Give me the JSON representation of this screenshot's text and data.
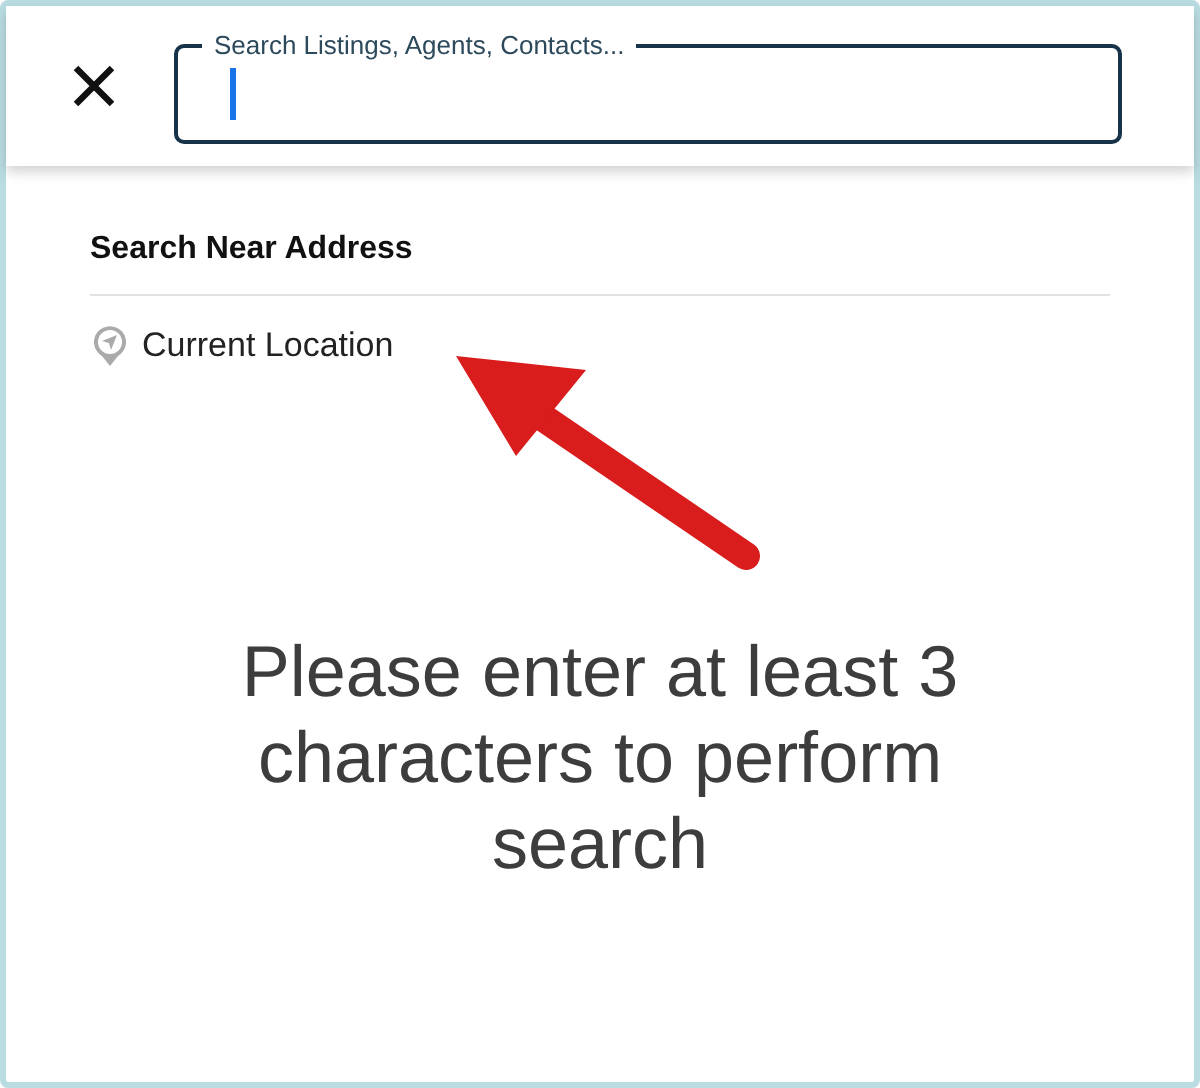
{
  "search": {
    "label": "Search Listings, Agents, Contacts..."
  },
  "section": {
    "title": "Search Near Address",
    "items": [
      {
        "label": "Current Location"
      }
    ]
  },
  "message": "Please enter at least 3 characters to perform search"
}
